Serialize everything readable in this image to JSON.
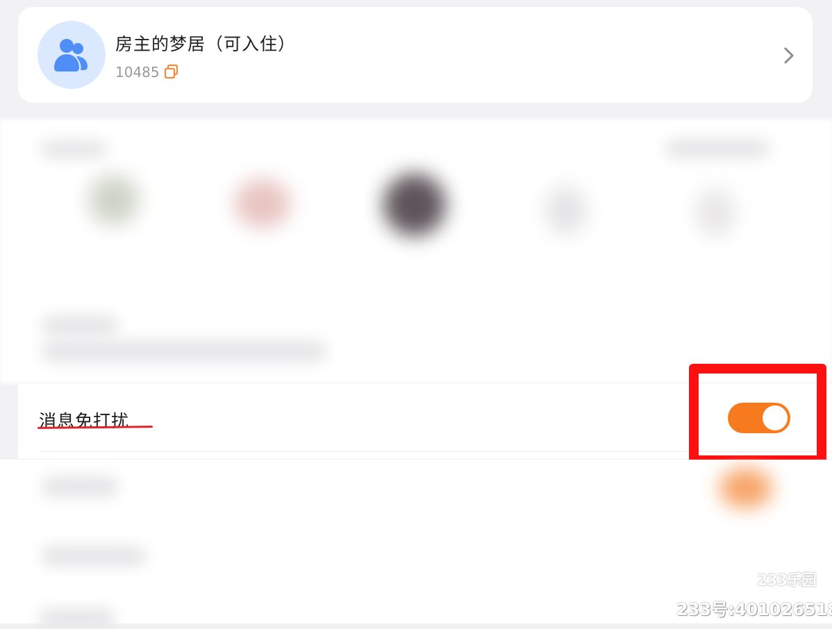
{
  "group_card": {
    "name": "房主的梦居（可入住）",
    "id": "10485",
    "avatar_icon": "group-users-icon",
    "copy_icon": "copy-icon",
    "chevron_icon": "chevron-right-icon"
  },
  "settings": {
    "do_not_disturb": {
      "label": "消息免打扰",
      "enabled": true
    }
  },
  "colors": {
    "toggle_on": "#f87a1f",
    "avatar_bg": "#dbe9fe",
    "avatar_icon": "#4f8ef7",
    "annotation_red": "#ff1010"
  },
  "watermark": {
    "logo": "233乐园",
    "account": "233号:401026518"
  }
}
